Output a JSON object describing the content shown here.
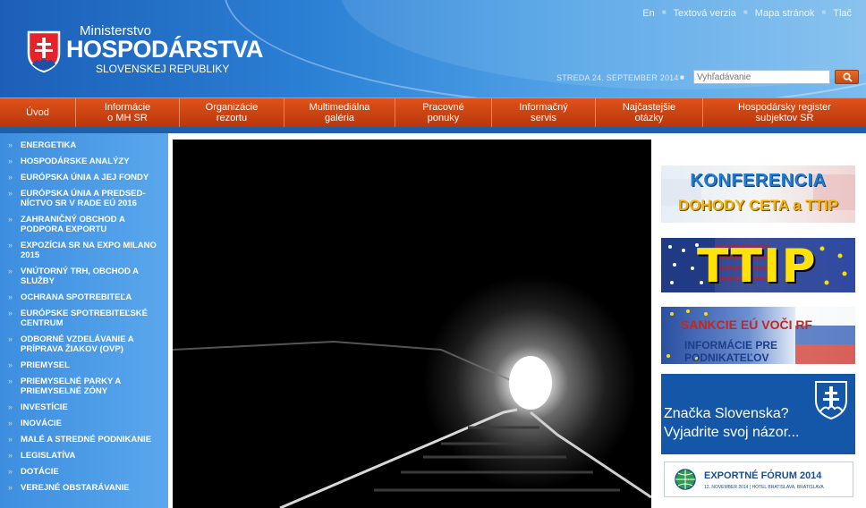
{
  "header": {
    "logo": {
      "line1": "Ministerstvo",
      "line2": "HOSPODÁRSTVA",
      "line3": "SLOVENSKEJ REPUBLIKY",
      "emblem_icon": "slovak-coat-of-arms-icon"
    },
    "util_links": [
      "En",
      "Textová verzia",
      "Mapa stránok",
      "Tlač"
    ],
    "date": "STREDA 24. SEPTEMBER 2014",
    "search": {
      "placeholder": "Vyhľadávanie",
      "button_icon": "search-icon"
    }
  },
  "nav": {
    "items": [
      "Úvod",
      "Informácie\no MH SR",
      "Organizácie\nrezortu",
      "Multimediálna\ngaléria",
      "Pracovné\nponuky",
      "Informačný\nservis",
      "Najčastejšie\notázky",
      "Hospodársky register\nsubjektov SR"
    ]
  },
  "sidebar": {
    "items": [
      "ENERGETIKA",
      "HOSPODÁRSKE ANALÝZY",
      "EURÓPSKA ÚNIA A JEJ FONDY",
      "EURÓPSKA ÚNIA A PREDSED-NÍCTVO SR V RADE EÚ 2016",
      "ZAHRANIČNÝ OBCHOD A PODPORA EXPORTU",
      "EXPOZÍCIA SR NA EXPO MILANO 2015",
      "VNÚTORNÝ TRH, OBCHOD A SLUŽBY",
      "OCHRANA SPOTREBITEĽA",
      "EURÓPSKE SPOTREBITEĽSKÉ CENTRUM",
      "ODBORNÉ VZDELÁVANIE A PRÍPRAVA ŽIAKOV (OVP)",
      "PRIEMYSEL",
      "PRIEMYSELNÉ PARKY A PRIEMYSELNÉ ZÓNY",
      "INVESTÍCIE",
      "INOVÁCIE",
      "MALÉ A STREDNÉ PODNIKANIE",
      "LEGISLATÍVA",
      "DOTÁCIE",
      "VEREJNÉ OBSTARÁVANIE"
    ]
  },
  "banners": {
    "konferencia": {
      "line1": "KONFERENCIA",
      "line2": "DOHODY CETA a TTIP"
    },
    "ttip": {
      "line1": "TTIP"
    },
    "sankcie": {
      "line1": "SANKCIE EÚ VOČI RF",
      "line2": "INFORMÁCIE PRE PODNIKATEĽOV"
    },
    "znacka": {
      "line1": "Značka Slovenska?",
      "line2": "Vyjadrite svoj názor..."
    },
    "forum": {
      "line1": "EXPORTNÉ FÓRUM 2014",
      "line2": "12. NOVEMBER 2014 | HOTEL BRATISLAVA, BRATISLAVA"
    }
  },
  "colors": {
    "header_blue": "#2a7fd4",
    "nav_orange": "#d0481a",
    "sidebar_blue": "#4a9ae6"
  }
}
